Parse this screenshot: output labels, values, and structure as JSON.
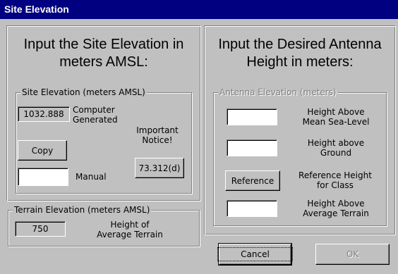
{
  "window": {
    "title": "Site Elevation"
  },
  "left": {
    "heading": [
      "Input the Site Elevation in",
      "meters AMSL:"
    ],
    "site_group": {
      "label": "Site Elevation (meters AMSL)",
      "computed_value": "1032.888",
      "computed_label": [
        "Computer",
        "Generated"
      ],
      "copy_button": "Copy",
      "manual_value": "",
      "manual_label": "Manual",
      "notice_label": [
        "Important",
        "Notice!"
      ],
      "notice_button": "73.312(d)"
    },
    "terrain_group": {
      "label": "Terrain Elevation (meters AMSL)",
      "value": "750",
      "value_label": [
        "Height of",
        "Average Terrain"
      ]
    }
  },
  "right": {
    "heading": [
      "Input the Desired Antenna",
      "Height in meters:"
    ],
    "antenna_group": {
      "label": "Antenna Elevation (meters)",
      "amsl_value": "",
      "amsl_label": [
        "Height Above",
        "Mean Sea-Level"
      ],
      "ground_value": "",
      "ground_label": [
        "Height above",
        "Ground"
      ],
      "reference_button": "Reference",
      "reference_label": [
        "Reference Height",
        "for Class"
      ],
      "haat_value": "",
      "haat_label": [
        "Height Above",
        "Average Terrain"
      ]
    }
  },
  "buttons": {
    "cancel": "Cancel",
    "ok": "OK"
  }
}
